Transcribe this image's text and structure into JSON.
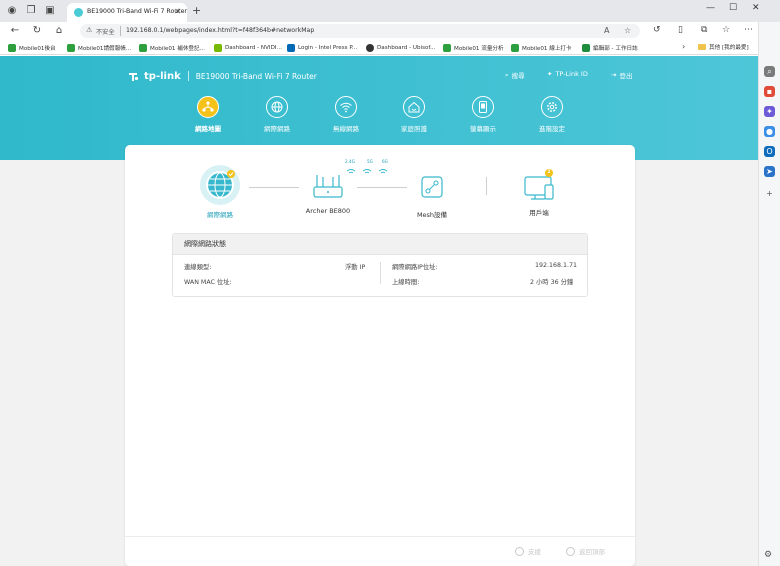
{
  "browser": {
    "tab_title": "BE19000 Tri-Band Wi-Fi 7 Router",
    "insecure_label": "不安全",
    "url": "192.168.0.1/webpages/index.html?t=f48f364b#networkMap",
    "bookmarks": [
      {
        "label": "Mobile01後台",
        "color": "#2e9f3e"
      },
      {
        "label": "Mobile01請假報帳...",
        "color": "#2e9f3e"
      },
      {
        "label": "Mobile01 補休登記...",
        "color": "#2e9f3e"
      },
      {
        "label": "Dashboard - NVIDI...",
        "color": "#76b900"
      },
      {
        "label": "Login - Intel Press P...",
        "color": "#0068b5"
      },
      {
        "label": "Dashboard - Ubisof...",
        "color": "#333333"
      },
      {
        "label": "Mobile01 流量分析",
        "color": "#2e9f3e"
      },
      {
        "label": "Mobile01 線上打卡",
        "color": "#2e9f3e"
      },
      {
        "label": "編輯部 - 工作日誌",
        "color": "#1e8e3e"
      }
    ],
    "bookmark_folder": "其他 [我的最愛]"
  },
  "router": {
    "brand": "tp-link",
    "model_title": "BE19000 Tri-Band Wi-Fi 7 Router",
    "header_links": {
      "search": "搜尋",
      "tplink_id": "TP-Link ID",
      "logout": "登出"
    },
    "nav": [
      {
        "label": "網路地圖",
        "icon": "network-map-icon",
        "active": true
      },
      {
        "label": "網際網路",
        "icon": "globe-icon",
        "active": false
      },
      {
        "label": "無線網路",
        "icon": "wifi-icon",
        "active": false
      },
      {
        "label": "家庭照護",
        "icon": "home-care-icon",
        "active": false
      },
      {
        "label": "螢幕顯示",
        "icon": "screen-icon",
        "active": false
      },
      {
        "label": "進階設定",
        "icon": "gear-icon",
        "active": false
      }
    ],
    "topology": {
      "internet_label": "網際網路",
      "router_label": "Archer BE800",
      "bands": [
        "2.4G",
        "5G",
        "6G"
      ],
      "mesh_label": "Mesh設備",
      "clients_label": "用戶端",
      "clients_count": "2"
    },
    "status": {
      "title": "網際網路狀態",
      "conn_type_label": "連線類型:",
      "conn_type_value": "浮動 IP",
      "wan_mac_label": "WAN MAC 位址:",
      "wan_mac_value": "",
      "ip_label": "網際網路IP位址:",
      "ip_value": "192.168.1.71",
      "uptime_label": "上線時間:",
      "uptime_value": "2 小時 36 分鐘"
    },
    "footer": {
      "support": "支援",
      "back_to_top": "返回頂部"
    }
  },
  "colors": {
    "brand_teal": "#3cc0d2",
    "active_blue": "#1f9fb8",
    "badge_yellow": "#f5c21a"
  }
}
